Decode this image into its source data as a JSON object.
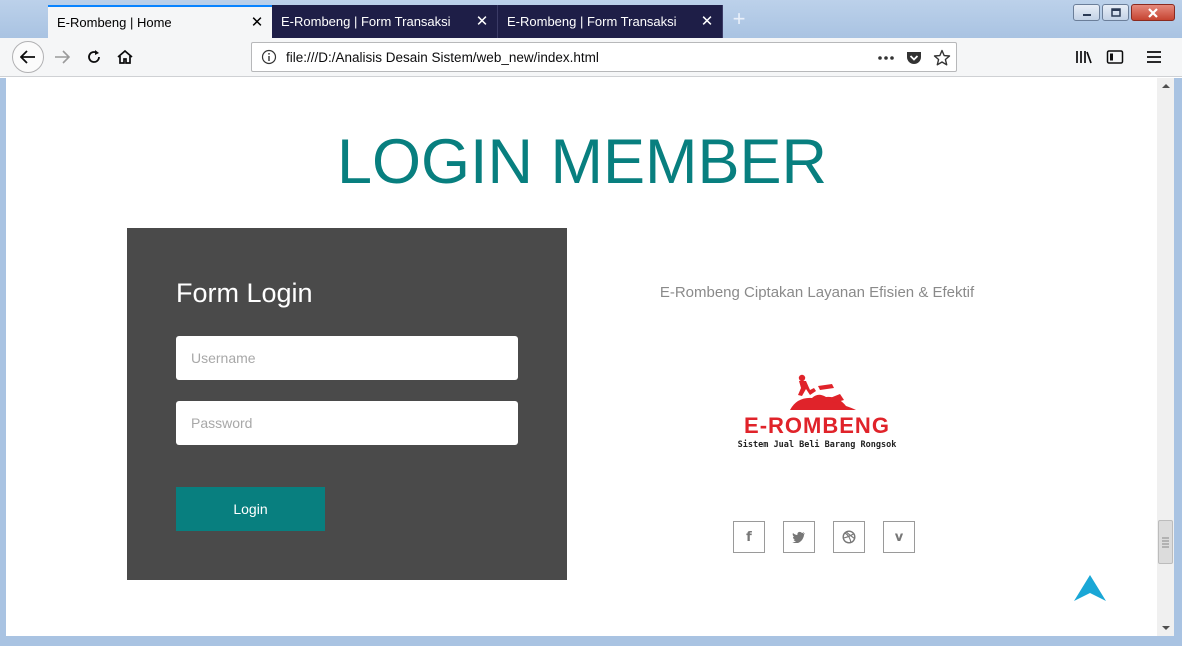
{
  "browser": {
    "tabs": [
      {
        "title": "E-Rombeng | Home"
      },
      {
        "title": "E-Rombeng | Form Transaksi"
      },
      {
        "title": "E-Rombeng | Form Transaksi"
      }
    ],
    "url": "file:///D:/Analisis Desain Sistem/web_new/index.html",
    "icons": [
      "back-icon",
      "forward-icon",
      "reload-icon",
      "home-icon",
      "info-icon",
      "more-icon",
      "pocket-icon",
      "bookmark-star-icon",
      "library-icon",
      "sidebar-icon",
      "menu-icon"
    ]
  },
  "page": {
    "title": "LOGIN MEMBER",
    "form": {
      "title": "Form Login",
      "username_placeholder": "Username",
      "password_placeholder": "Password",
      "login_label": "Login"
    },
    "tagline": "E-Rombeng Ciptakan Layanan Efisien & Efektif",
    "logo": {
      "title": "E-ROMBENG",
      "subtitle": "Sistem Jual Beli Barang Rongsok"
    },
    "social": [
      {
        "icon": "facebook-icon",
        "glyph": "f"
      },
      {
        "icon": "twitter-icon",
        "glyph": "t"
      },
      {
        "icon": "dribbble-icon",
        "glyph": "◎"
      },
      {
        "icon": "vimeo-icon",
        "glyph": "v"
      }
    ]
  },
  "colors": {
    "accent": "#087f7f",
    "panel": "#4a4a4a",
    "logo_red": "#e0232a",
    "scroll_top": "#1aa7d6"
  }
}
